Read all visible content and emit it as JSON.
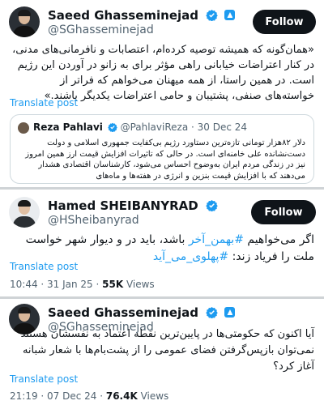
{
  "colors": {
    "link": "#1d9bf0",
    "text": "#0f1419",
    "muted": "#536471",
    "button": "#0f1419"
  },
  "tweet1": {
    "name": "Saeed Ghasseminejad",
    "handle": "@SGhasseminejad",
    "follow_label": "Follow",
    "text": "«همان‌گونه که همیشه توصیه کرده‌ام، اعتصابات و نافرمانی‌های مدنی، در کنار اعتراضات خیابانی راهی مؤثر برای به زانو در آوردن این رژیم است. در همین راستا، از همه میهنان می‌خواهم که فراتر از خواسته‌های صنفی، پشتیبان و حامی اعتراضات یکدیگر باشند.»",
    "translate_label": "Translate post",
    "quote": {
      "name": "Reza Pahlavi",
      "handle": "@PahlaviReza",
      "sep": "·",
      "date": "30 Dec 24",
      "text": "دلار ۸۲هزار تومانی تازه‌ترین دستاورد رژیم بی‌کفایت جمهوری اسلامی و دولت دست‌نشانده علی خامنه‌ای است. در حالی که تاثیرات افزایش قیمت ارز همین امروز نیز در زندگی مردم ایران به‌وضوح احساس می‌شود، کارشناسان اقتصادی هشدار می‌دهند که با افزایش قیمت بنزین و انرژی در هفته‌ها و ماه‌های"
    }
  },
  "tweet2": {
    "name": "Hamed SHEIBANYRAD",
    "handle": "@HSheibanyrad",
    "follow_label": "Follow",
    "text_part1": "اگر می‌خواهیم ",
    "hashtag1": "#بهمن_آخر",
    "text_part2": " باشد، باید در و دیوار شهر خواست ملت را فریاد زند: ",
    "hashtag2": "#پهلوی_می_آید",
    "translate_label": "Translate post",
    "time": "10:44 · 31 Jan 25 · ",
    "views_count": "55K",
    "views_label": " Views"
  },
  "tweet3": {
    "name": "Saeed Ghasseminejad",
    "handle": "@SGhasseminejad",
    "text": "آیا اکنون که حکومتی‌ها در پایین‌ترین نقطه اعتماد به نفسشان هستند نمی‌توان بازپس‌گرفتن فضای عمومی را از پشت‌بام‌ها با شعار شبانه آغاز کرد؟",
    "translate_label": "Translate post",
    "time": "21:19 · 07 Dec 24 · ",
    "views_count": "76.4K",
    "views_label": " Views"
  }
}
